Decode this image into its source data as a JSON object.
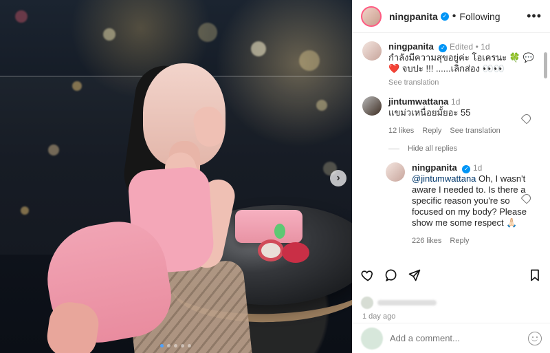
{
  "post": {
    "username": "ningpanita",
    "follow_status": "Following",
    "more_label": "•••",
    "caption_user": "ningpanita",
    "caption_edited": "Edited",
    "caption_time": "1d",
    "caption_text": "กำลังมีความสุขอยู่ค่ะ โอเครนะ 🍀 💬 ❤️ จบปะ !!! ......เลิกส่อง 👀👀",
    "see_translation": "See translation",
    "next_label": "›"
  },
  "comments": [
    {
      "user": "jintumwattana",
      "time": "1d",
      "text": "แขม่วเหนื่อยมั้ยอะ 55",
      "likes": "12 likes",
      "reply": "Reply",
      "translate": "See translation"
    }
  ],
  "thread": {
    "hide_replies": "Hide all replies"
  },
  "reply": {
    "user": "ningpanita",
    "time": "1d",
    "mention": "@jintumwattana",
    "text": " Oh, I wasn't aware I needed to. Is there a specific reason you're so focused on my body? Please show me some respect 🙏🏻",
    "likes": "226 likes",
    "reply": "Reply"
  },
  "footer": {
    "date": "1 day ago",
    "comment_placeholder": "Add a comment..."
  },
  "icons": {
    "verified": "verified-icon",
    "heart": "heart-icon",
    "comment": "comment-icon",
    "share": "share-icon",
    "bookmark": "bookmark-icon",
    "emoji": "emoji-icon"
  }
}
